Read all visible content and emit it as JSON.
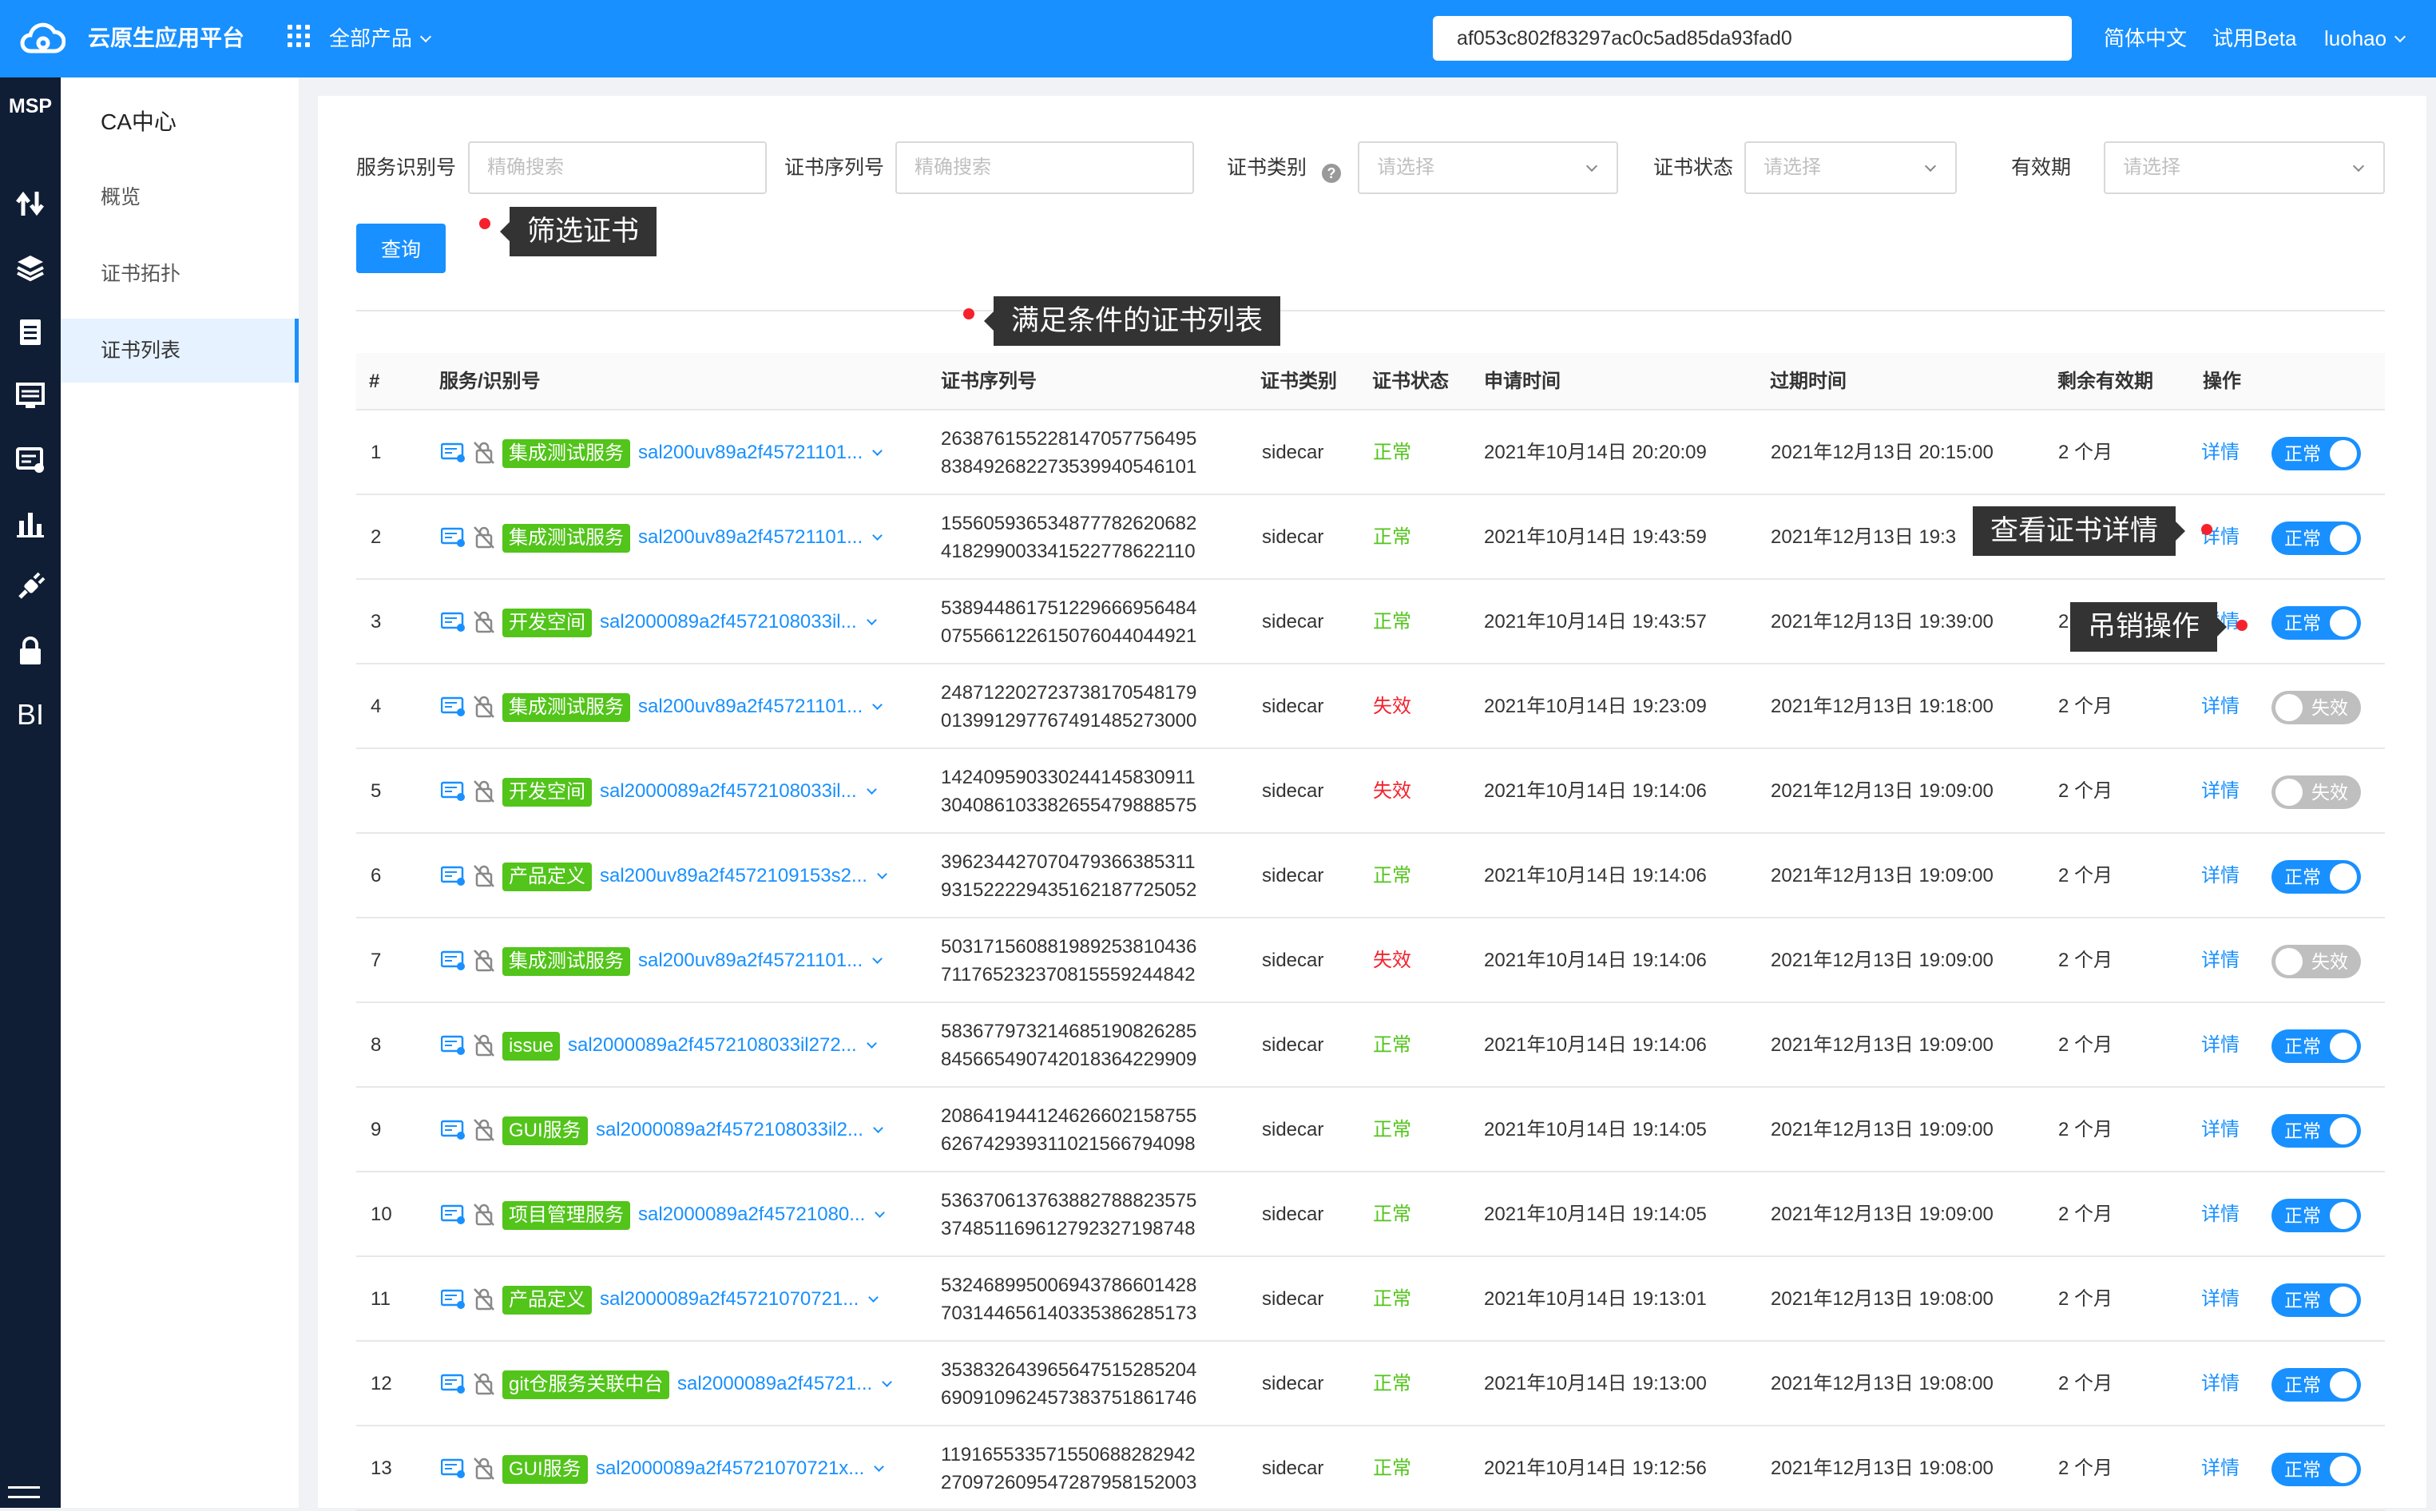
{
  "topbar": {
    "brand": "云原生应用平台",
    "all_products": "全部产品",
    "search_value": "af053c802f83297ac0c5ad85da93fad0",
    "lang": "简体中文",
    "beta": "试用Beta",
    "user": "luohao"
  },
  "nav": {
    "msp": "MSP",
    "icons": [
      "transfer-icon",
      "layers-icon",
      "clipboard-icon",
      "monitor-icon",
      "service-card-icon",
      "bar-chart-icon",
      "plug-icon",
      "lock-icon",
      "bi-icon"
    ],
    "bi": "BI"
  },
  "sidebar": {
    "title": "CA中心",
    "items": [
      {
        "label": "概览"
      },
      {
        "label": "证书拓扑"
      },
      {
        "label": "证书列表"
      }
    ]
  },
  "filters": {
    "service_label": "服务识别号",
    "service_placeholder": "精确搜索",
    "serial_label": "证书序列号",
    "serial_placeholder": "精确搜索",
    "type_label": "证书类别",
    "type_placeholder": "请选择",
    "status_label": "证书状态",
    "status_placeholder": "请选择",
    "validity_label": "有效期",
    "validity_placeholder": "请选择",
    "query_button": "查询"
  },
  "callouts": {
    "filter": "筛选证书",
    "list": "满足条件的证书列表",
    "detail": "查看证书详情",
    "revoke": "吊销操作"
  },
  "colors": {
    "primary": "#1890ff",
    "success": "#52c41a",
    "danger": "#f5222d",
    "nav_bg": "#0f1d35"
  },
  "table": {
    "headers": [
      "#",
      "服务/识别号",
      "证书序列号",
      "证书类别",
      "证书状态",
      "申请时间",
      "过期时间",
      "剩余有效期",
      "操作"
    ],
    "detail_label": "详情",
    "rows": [
      {
        "idx": "1",
        "tag": "集成测试服务",
        "sid": "sal200uv89a2f45721101...",
        "serial1": "263876155228147057756495",
        "serial2": "838492682273539940546101",
        "type": "sidecar",
        "status": "正常",
        "ok": true,
        "applied": "2021年10月14日 20:20:09",
        "expires": "2021年12月13日 20:15:00",
        "remain": "2 个月",
        "toggle": "正常"
      },
      {
        "idx": "2",
        "tag": "集成测试服务",
        "sid": "sal200uv89a2f45721101...",
        "serial1": "155605936534877782620682",
        "serial2": "418299003341522778622110",
        "type": "sidecar",
        "status": "正常",
        "ok": true,
        "applied": "2021年10月14日 19:43:59",
        "expires": "2021年12月13日 19:3",
        "remain": "",
        "toggle": "正常"
      },
      {
        "idx": "3",
        "tag": "开发空间",
        "sid": "sal2000089a2f4572108033il...",
        "serial1": "538944861751229666956484",
        "serial2": "075566122615076044044921",
        "type": "sidecar",
        "status": "正常",
        "ok": true,
        "applied": "2021年10月14日 19:43:57",
        "expires": "2021年12月13日 19:39:00",
        "remain": "2",
        "toggle": "正常"
      },
      {
        "idx": "4",
        "tag": "集成测试服务",
        "sid": "sal200uv89a2f45721101...",
        "serial1": "248712202723738170548179",
        "serial2": "013991297767491485273000",
        "type": "sidecar",
        "status": "失效",
        "ok": false,
        "applied": "2021年10月14日 19:23:09",
        "expires": "2021年12月13日 19:18:00",
        "remain": "2 个月",
        "toggle": "失效"
      },
      {
        "idx": "5",
        "tag": "开发空间",
        "sid": "sal2000089a2f4572108033il...",
        "serial1": "142409590330244145830911",
        "serial2": "304086103382655479888575",
        "type": "sidecar",
        "status": "失效",
        "ok": false,
        "applied": "2021年10月14日 19:14:06",
        "expires": "2021年12月13日 19:09:00",
        "remain": "2 个月",
        "toggle": "失效"
      },
      {
        "idx": "6",
        "tag": "产品定义",
        "sid": "sal200uv89a2f4572109153s2...",
        "serial1": "396234427070479366385311",
        "serial2": "931522229435162187725052",
        "type": "sidecar",
        "status": "正常",
        "ok": true,
        "applied": "2021年10月14日 19:14:06",
        "expires": "2021年12月13日 19:09:00",
        "remain": "2 个月",
        "toggle": "正常"
      },
      {
        "idx": "7",
        "tag": "集成测试服务",
        "sid": "sal200uv89a2f45721101...",
        "serial1": "503171560881989253810436",
        "serial2": "711765232370815559244842",
        "type": "sidecar",
        "status": "失效",
        "ok": false,
        "applied": "2021年10月14日 19:14:06",
        "expires": "2021年12月13日 19:09:00",
        "remain": "2 个月",
        "toggle": "失效"
      },
      {
        "idx": "8",
        "tag": "issue",
        "sid": "sal2000089a2f4572108033il272...",
        "serial1": "583677973214685190826285",
        "serial2": "845665490742018364229909",
        "type": "sidecar",
        "status": "正常",
        "ok": true,
        "applied": "2021年10月14日 19:14:06",
        "expires": "2021年12月13日 19:09:00",
        "remain": "2 个月",
        "toggle": "正常"
      },
      {
        "idx": "9",
        "tag": "GUI服务",
        "sid": "sal2000089a2f4572108033il2...",
        "serial1": "208641944124626602158755",
        "serial2": "626742939311021566794098",
        "type": "sidecar",
        "status": "正常",
        "ok": true,
        "applied": "2021年10月14日 19:14:05",
        "expires": "2021年12月13日 19:09:00",
        "remain": "2 个月",
        "toggle": "正常"
      },
      {
        "idx": "10",
        "tag": "项目管理服务",
        "sid": "sal2000089a2f45721080...",
        "serial1": "536370613763882788823575",
        "serial2": "374851169612792327198748",
        "type": "sidecar",
        "status": "正常",
        "ok": true,
        "applied": "2021年10月14日 19:14:05",
        "expires": "2021年12月13日 19:09:00",
        "remain": "2 个月",
        "toggle": "正常"
      },
      {
        "idx": "11",
        "tag": "产品定义",
        "sid": "sal2000089a2f45721070721...",
        "serial1": "532468995006943786601428",
        "serial2": "703144656140335386285173",
        "type": "sidecar",
        "status": "正常",
        "ok": true,
        "applied": "2021年10月14日 19:13:01",
        "expires": "2021年12月13日 19:08:00",
        "remain": "2 个月",
        "toggle": "正常"
      },
      {
        "idx": "12",
        "tag": "git仓服务关联中台",
        "sid": "sal2000089a2f45721...",
        "serial1": "353832643965647515285204",
        "serial2": "690910962457383751861746",
        "type": "sidecar",
        "status": "正常",
        "ok": true,
        "applied": "2021年10月14日 19:13:00",
        "expires": "2021年12月13日 19:08:00",
        "remain": "2 个月",
        "toggle": "正常"
      },
      {
        "idx": "13",
        "tag": "GUI服务",
        "sid": "sal2000089a2f45721070721x...",
        "serial1": "119165533571550688282942",
        "serial2": "270972609547287958152003",
        "type": "sidecar",
        "status": "正常",
        "ok": true,
        "applied": "2021年10月14日 19:12:56",
        "expires": "2021年12月13日 19:08:00",
        "remain": "2 个月",
        "toggle": "正常"
      }
    ]
  }
}
